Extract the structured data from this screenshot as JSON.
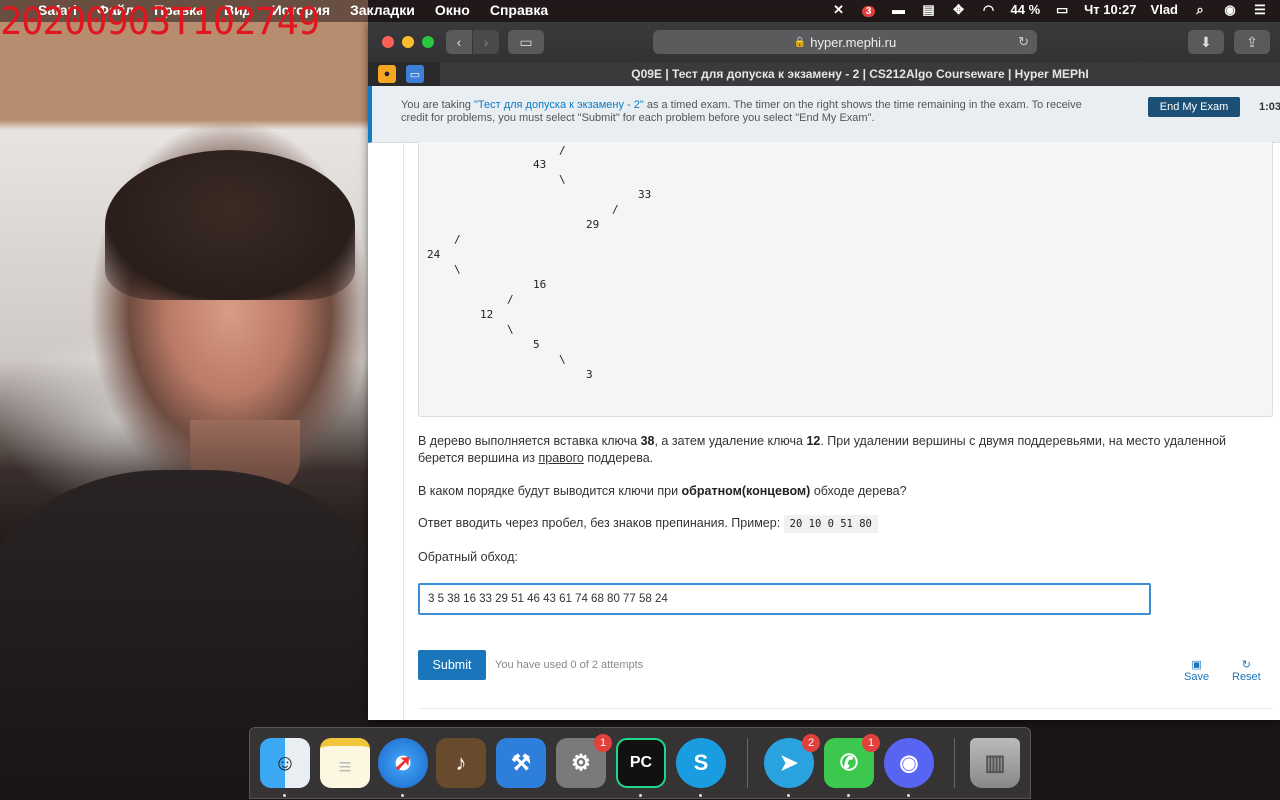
{
  "overlay": {
    "timestamp": "20200903T102749"
  },
  "menubar": {
    "apple": "",
    "app": "Safari",
    "menus": [
      "Файл",
      "Правка",
      "Вид",
      "История",
      "Закладки",
      "Окно",
      "Справка"
    ],
    "battery": "44 %",
    "clock": "Чт 10:27",
    "user": "Vlad",
    "notif_badge": "3"
  },
  "browser": {
    "url": "hyper.mephi.ru",
    "tab_title": "Q09E | Тест для допуска к экзамену - 2 | CS212Algo Courseware | Hyper MEPhI"
  },
  "banner": {
    "text_before": "You are taking ",
    "exam_link": "\"Тест для допуска к экзамену - 2\"",
    "text_after": " as a timed exam. The timer on the right shows the time remaining in the exam. To receive credit for problems, you must select \"Submit\" for each problem before you select \"End My Exam\".",
    "end_button": "End My Exam",
    "timer": "1:03:"
  },
  "tree": [
    "/",
    "43",
    "\\",
    "33",
    "/",
    "29",
    "/",
    "24",
    "\\",
    "16",
    "/",
    "12",
    "\\",
    "5",
    "\\",
    "3"
  ],
  "problem": {
    "p1_a": "В дерево выполняется вставка ключа ",
    "p1_k1": "38",
    "p1_b": ", а затем удаление ключа ",
    "p1_k2": "12",
    "p1_c": ". При удалении вершины с двумя поддеревьями, на место удаленной берется вершина из ",
    "p1_u": "правого",
    "p1_d": " поддерева.",
    "p2_a": "В каком порядке будут выводится ключи при ",
    "p2_b": "обратном(концевом)",
    "p2_c": " обходе дерева?",
    "p3_a": "Ответ вводить через пробел, без знаков препинания. Пример: ",
    "p3_code": "20 10 0 51 80",
    "label": "Обратный обход:",
    "answer": "3 5 38 16 33 29 51 46 43 61 74 68 80 77 58 24",
    "submit": "Submit",
    "attempts": "You have used 0 of 2 attempts",
    "save": "Save",
    "reset": "Reset"
  },
  "dock": {
    "sysprefs_badge": "1",
    "telegram_badge": "2",
    "facetime_badge": "1",
    "pycharm_label": "PC"
  }
}
